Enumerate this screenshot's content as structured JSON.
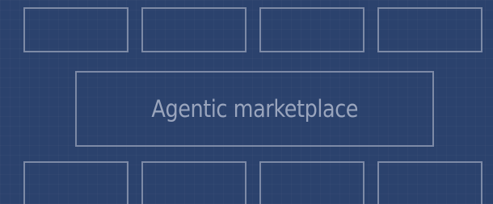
{
  "center_box": {
    "label": "Agentic marketplace"
  },
  "colors": {
    "background": "#2b426d",
    "outline": "#7d8aa6",
    "text": "#9aa5bd"
  }
}
